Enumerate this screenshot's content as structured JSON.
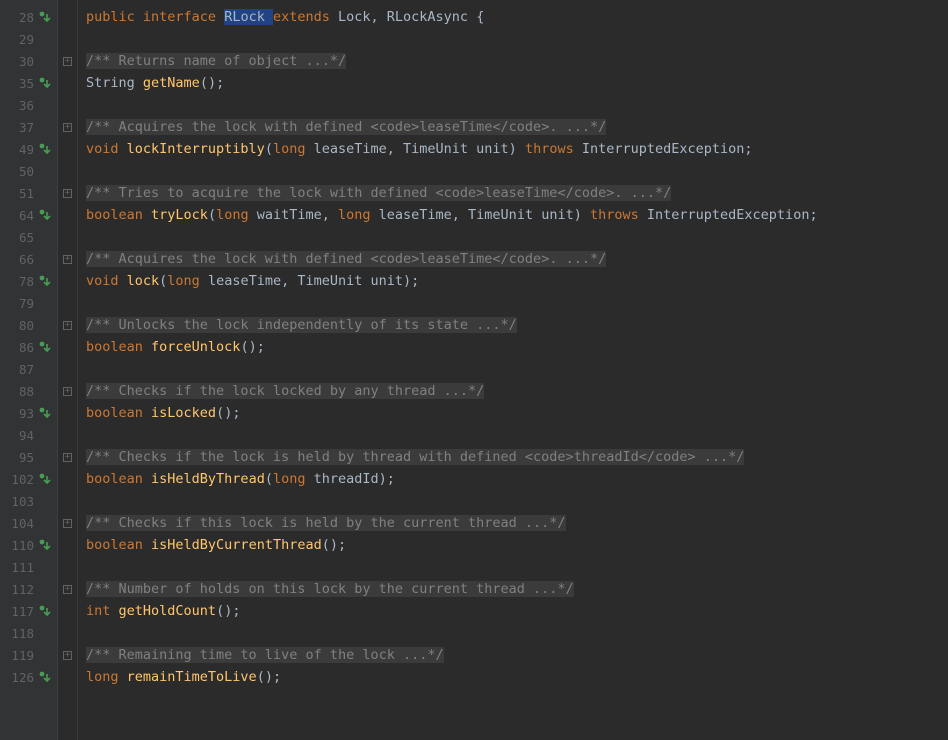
{
  "gutter": [
    {
      "num": "28",
      "marker": "impl"
    },
    {
      "num": "29"
    },
    {
      "num": "30",
      "fold": "plus"
    },
    {
      "num": "35",
      "marker": "impl"
    },
    {
      "num": "36"
    },
    {
      "num": "37",
      "fold": "plus"
    },
    {
      "num": "49",
      "marker": "impl"
    },
    {
      "num": "50"
    },
    {
      "num": "51",
      "fold": "plus"
    },
    {
      "num": "64",
      "marker": "impl"
    },
    {
      "num": "65"
    },
    {
      "num": "66",
      "fold": "plus"
    },
    {
      "num": "78",
      "marker": "impl"
    },
    {
      "num": "79"
    },
    {
      "num": "80",
      "fold": "plus"
    },
    {
      "num": "86",
      "marker": "impl"
    },
    {
      "num": "87"
    },
    {
      "num": "88",
      "fold": "plus"
    },
    {
      "num": "93",
      "marker": "impl"
    },
    {
      "num": "94"
    },
    {
      "num": "95",
      "fold": "plus"
    },
    {
      "num": "102",
      "marker": "impl"
    },
    {
      "num": "103"
    },
    {
      "num": "104",
      "fold": "plus"
    },
    {
      "num": "110",
      "marker": "impl"
    },
    {
      "num": "111"
    },
    {
      "num": "112",
      "fold": "plus"
    },
    {
      "num": "117",
      "marker": "impl"
    },
    {
      "num": "118"
    },
    {
      "num": "119",
      "fold": "plus"
    },
    {
      "num": "126",
      "marker": "impl"
    }
  ],
  "code": {
    "l28": {
      "public": "public ",
      "interface": "interface ",
      "RLock": "RLock ",
      "extends": "extends ",
      "Lock": "Lock, ",
      "RLockAsync": "RLockAsync ",
      "brace": "{"
    },
    "l30": "/** Returns name of object ...*/",
    "l35": {
      "ret": "String ",
      "name": "getName",
      "tail": "();"
    },
    "l37": {
      "open": "/** Acquires the lock with defined ",
      "codeOpen": "<code>",
      "codeBody": "leaseTime",
      "codeClose": "</code>",
      "rest": ". ...*/"
    },
    "l49": {
      "ret": "void ",
      "name": "lockInterruptibly",
      "p": "(",
      "kw1": "long ",
      "p1": "leaseTime, ",
      "t2": "TimeUnit ",
      "p2": "unit) ",
      "throws": "throws ",
      "ex": "InterruptedException;"
    },
    "l51": {
      "open": "/** Tries to acquire the lock with defined ",
      "codeOpen": "<code>",
      "codeBody": "leaseTime",
      "codeClose": "</code>",
      "rest": ". ...*/"
    },
    "l64": {
      "ret": "boolean ",
      "name": "tryLock",
      "p": "(",
      "kw1": "long ",
      "p1": "waitTime, ",
      "kw2": "long ",
      "p2": "leaseTime, ",
      "t3": "TimeUnit ",
      "p3": "unit) ",
      "throws": "throws ",
      "ex": "InterruptedException;"
    },
    "l66": {
      "open": "/** Acquires the lock with defined ",
      "codeOpen": "<code>",
      "codeBody": "leaseTime",
      "codeClose": "</code>",
      "rest": ". ...*/"
    },
    "l78": {
      "ret": "void ",
      "name": "lock",
      "p": "(",
      "kw1": "long ",
      "p1": "leaseTime, ",
      "t2": "TimeUnit ",
      "p2": "unit);",
      "tail": ""
    },
    "l80": "/** Unlocks the lock independently of its state ...*/",
    "l86": {
      "ret": "boolean ",
      "name": "forceUnlock",
      "tail": "();"
    },
    "l88": "/** Checks if the lock locked by any thread ...*/",
    "l93": {
      "ret": "boolean ",
      "name": "isLocked",
      "tail": "();"
    },
    "l95": {
      "open": "/** Checks if the lock is held by thread with defined ",
      "codeOpen": "<code>",
      "codeBody": "threadId",
      "codeClose": "</code>",
      "rest": " ...*/"
    },
    "l102": {
      "ret": "boolean ",
      "name": "isHeldByThread",
      "p": "(",
      "kw1": "long ",
      "p1": "threadId);",
      "tail": ""
    },
    "l104": "/** Checks if this lock is held by the current thread ...*/",
    "l110": {
      "ret": "boolean ",
      "name": "isHeldByCurrentThread",
      "tail": "();"
    },
    "l112": "/** Number of holds on this lock by the current thread ...*/",
    "l117": {
      "ret": "int ",
      "name": "getHoldCount",
      "tail": "();"
    },
    "l119": "/** Remaining time to live of the lock ...*/",
    "l126": {
      "ret": "long ",
      "name": "remainTimeToLive",
      "tail": "();"
    }
  }
}
